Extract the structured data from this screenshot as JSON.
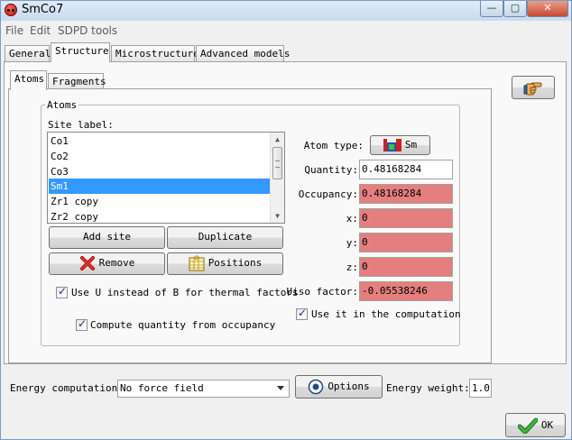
{
  "window": {
    "title": "SmCo7",
    "minimize": "—",
    "maximize": "▢",
    "close": "✕"
  },
  "menu": [
    "File",
    "Edit",
    "SDPD tools"
  ],
  "main_tabs": [
    "General",
    "Structure",
    "Microstructure",
    "Advanced models"
  ],
  "main_tabs_active": "Structure",
  "sub_tabs": [
    "Atoms",
    "Fragments"
  ],
  "sub_tabs_active": "Atoms",
  "atoms_group": {
    "title": "Atoms",
    "site_label": "Site label:",
    "sites": [
      "Co1",
      "Co2",
      "Co3",
      "Sm1",
      "Zr1 copy",
      "Zr2 copy"
    ],
    "selected_site": "Sm1",
    "add_site": "Add site",
    "duplicate": "Duplicate",
    "remove": "Remove",
    "positions": "Positions",
    "use_u_label": "Use U instead of B for thermal factors",
    "use_u_checked": true,
    "compute_qty_label": "Compute quantity from occupancy",
    "compute_qty_checked": true
  },
  "atom_props": {
    "atom_type_label": "Atom type:",
    "atom_type_value": "Sm",
    "quantity_label": "Quantity:",
    "quantity_value": "0.48168284",
    "occupancy_label": "Occupancy:",
    "occupancy_value": "0.48168284",
    "x_label": "x:",
    "x_value": "0",
    "y_label": "y:",
    "y_value": "0",
    "z_label": "z:",
    "z_value": "0",
    "uiso_label": "Uiso factor:",
    "uiso_value": "-0.05538246",
    "use_in_comp_label": "Use it in the computation",
    "use_in_comp_checked": true
  },
  "bottom": {
    "energy_label": "Energy computation:",
    "energy_value": "No force field",
    "options": "Options",
    "weight_label": "Energy weight:",
    "weight_value": "1.0",
    "ok": "OK"
  },
  "colors": {
    "selection": "#3399ff",
    "refined_field": "#e57f7f"
  }
}
